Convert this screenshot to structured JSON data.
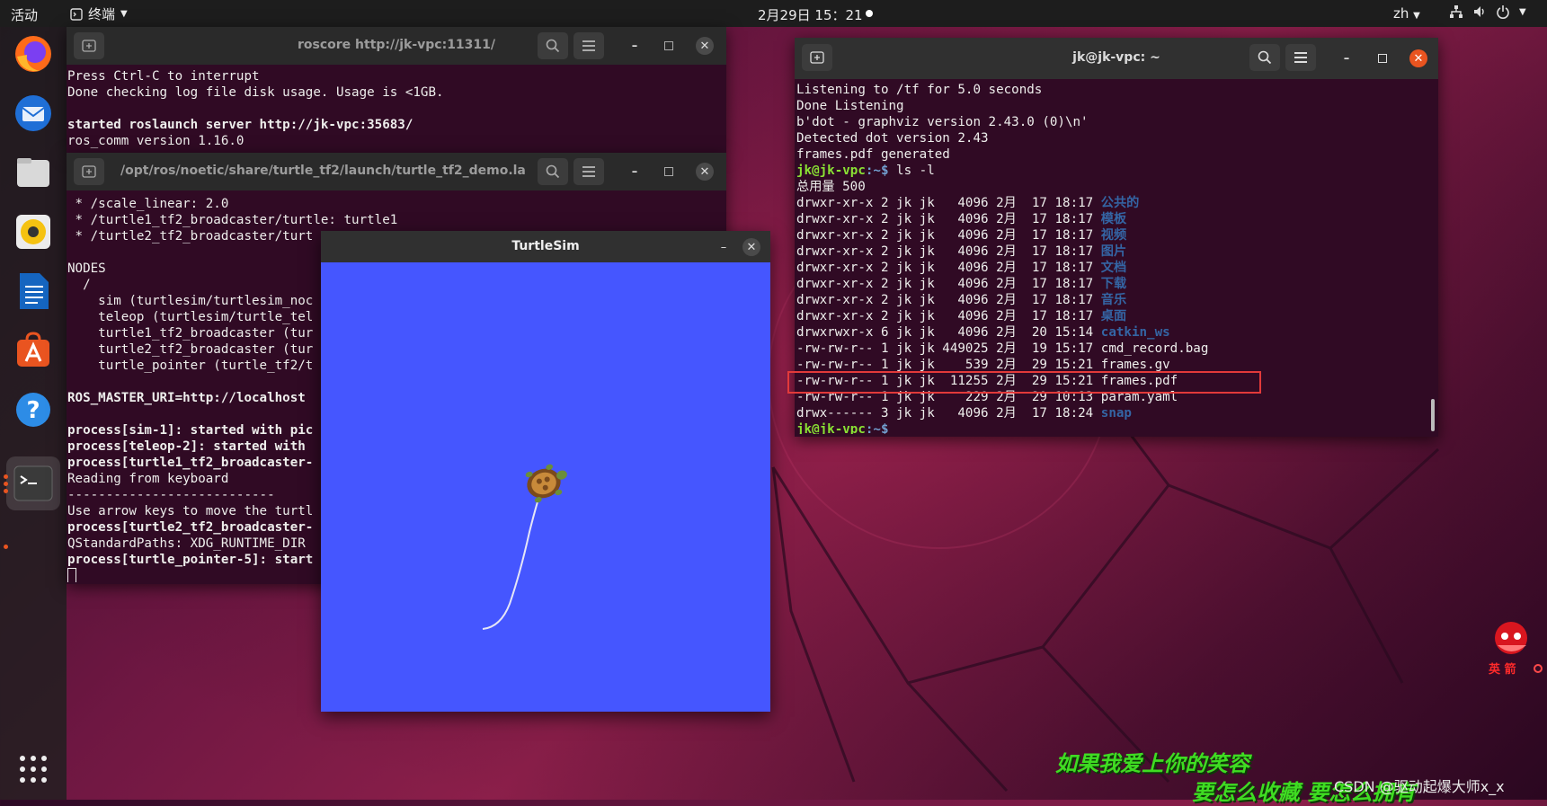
{
  "topbar": {
    "activities": "活动",
    "app_menu": "终端",
    "clock": "2月29日 15：21",
    "lang": "zh"
  },
  "dock": {
    "items": [
      "firefox-icon",
      "thunderbird-icon",
      "files-icon",
      "rhythmbox-icon",
      "libreoffice-writer-icon",
      "app-center-icon",
      "help-icon",
      "terminal-icon",
      "show-apps-icon"
    ]
  },
  "roscore_window": {
    "title": "roscore http://jk-vpc:11311/",
    "lines": [
      "Press Ctrl-C to interrupt",
      "Done checking log file disk usage. Usage is <1GB.",
      "",
      "started roslaunch server http://jk-vpc:35683/",
      "ros_comm version 1.16.0"
    ]
  },
  "launch_window": {
    "title": "/opt/ros/noetic/share/turtle_tf2/launch/turtle_tf2_demo.la...",
    "lines": [
      " * /scale_linear: 2.0",
      " * /turtle1_tf2_broadcaster/turtle: turtle1",
      " * /turtle2_tf2_broadcaster/turt",
      "",
      "NODES",
      "  /",
      "    sim (turtlesim/turtlesim_noc",
      "    teleop (turtlesim/turtle_tel",
      "    turtle1_tf2_broadcaster (tur",
      "    turtle2_tf2_broadcaster (tur",
      "    turtle_pointer (turtle_tf2/t",
      "",
      "ROS_MASTER_URI=http://localhost",
      "",
      "process[sim-1]: started with pic",
      "process[teleop-2]: started with",
      "process[turtle1_tf2_broadcaster-",
      "Reading from keyboard",
      "---------------------------",
      "Use arrow keys to move the turtl",
      "process[turtle2_tf2_broadcaster-",
      "QStandardPaths: XDG_RUNTIME_DIR",
      "process[turtle_pointer-5]: start"
    ]
  },
  "turtlesim_window": {
    "title": "TurtleSim",
    "background_color": "#4556ff"
  },
  "home_terminal": {
    "title": "jk@jk-vpc: ~",
    "output_lines": [
      "Listening to /tf for 5.0 seconds",
      "Done Listening",
      "b'dot - graphviz version 2.43.0 (0)\\n'",
      "Detected dot version 2.43",
      "frames.pdf generated"
    ],
    "prompt_user": "jk@jk-vpc",
    "prompt_path": ":~$ ",
    "command": "ls -l",
    "total": "总用量 500",
    "entries": [
      {
        "meta": "drwxr-xr-x 2 jk jk   4096 2月  17 18:17 ",
        "name": "公共的",
        "type": "dir"
      },
      {
        "meta": "drwxr-xr-x 2 jk jk   4096 2月  17 18:17 ",
        "name": "模板",
        "type": "dir"
      },
      {
        "meta": "drwxr-xr-x 2 jk jk   4096 2月  17 18:17 ",
        "name": "视频",
        "type": "dir"
      },
      {
        "meta": "drwxr-xr-x 2 jk jk   4096 2月  17 18:17 ",
        "name": "图片",
        "type": "dir"
      },
      {
        "meta": "drwxr-xr-x 2 jk jk   4096 2月  17 18:17 ",
        "name": "文档",
        "type": "dir"
      },
      {
        "meta": "drwxr-xr-x 2 jk jk   4096 2月  17 18:17 ",
        "name": "下载",
        "type": "dir"
      },
      {
        "meta": "drwxr-xr-x 2 jk jk   4096 2月  17 18:17 ",
        "name": "音乐",
        "type": "dir"
      },
      {
        "meta": "drwxr-xr-x 2 jk jk   4096 2月  17 18:17 ",
        "name": "桌面",
        "type": "dir"
      },
      {
        "meta": "drwxrwxr-x 6 jk jk   4096 2月  20 15:14 ",
        "name": "catkin_ws",
        "type": "dir"
      },
      {
        "meta": "-rw-rw-r-- 1 jk jk 449025 2月  19 15:17 ",
        "name": "cmd_record.bag",
        "type": "file"
      },
      {
        "meta": "-rw-rw-r-- 1 jk jk    539 2月  29 15:21 ",
        "name": "frames.gv",
        "type": "file"
      },
      {
        "meta": "-rw-rw-r-- 1 jk jk  11255 2月  29 15:21 ",
        "name": "frames.pdf",
        "type": "file"
      },
      {
        "meta": "-rw-rw-r-- 1 jk jk    229 2月  29 10:13 ",
        "name": "param.yaml",
        "type": "file"
      },
      {
        "meta": "drwx------ 3 jk jk   4096 2月  17 18:24 ",
        "name": "snap",
        "type": "dir"
      }
    ],
    "final_prompt_path": ":~$"
  },
  "overlay": {
    "lyric_line1": "如果我爱上你的笑容",
    "lyric_line2": "要怎么收藏 要怎么拥有",
    "watermark": "CSDN @驱动起爆大师x_x",
    "mascot_caption": "英 箭"
  }
}
